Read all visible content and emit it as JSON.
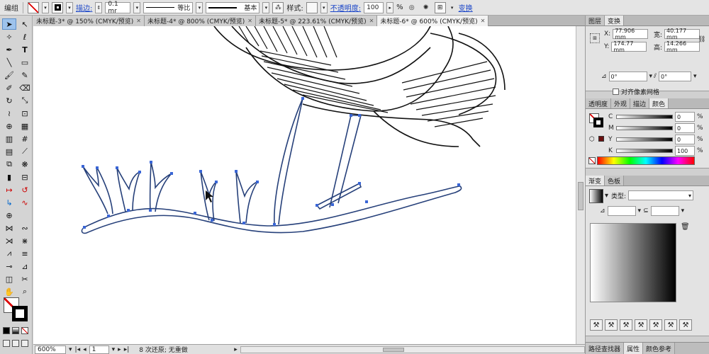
{
  "control_bar": {
    "selection_label": "编组",
    "stroke_label": "描边:",
    "stroke_value": "0.1 mr",
    "profile_uniform": "等比",
    "brush_basic": "基本",
    "style_label": "样式:",
    "opacity_label": "不透明度:",
    "opacity_value": "100",
    "opacity_unit": "%",
    "transform_label": "变换"
  },
  "tabs": [
    {
      "label": "未标题-3* @ 150% (CMYK/预览)"
    },
    {
      "label": "未标题-4* @ 800% (CMYK/预览)"
    },
    {
      "label": "未标题-5* @ 223.61% (CMYK/预览)"
    },
    {
      "label": "未标题-6* @ 600% (CMYK/预览)"
    }
  ],
  "status": {
    "zoom": "600%",
    "artboard": "1",
    "history": "8 次还原; 无重做"
  },
  "transform_panel": {
    "tab_layers": "图层",
    "tab_transform": "变换",
    "x_label": "X:",
    "x_value": "77.906 mm",
    "y_label": "Y:",
    "y_value": "174.77 mm",
    "w_label": "宽:",
    "w_value": "40.177 mm",
    "h_label": "高:",
    "h_value": "14.266 mm",
    "rotate_value": "0°",
    "shear_value": "0°",
    "align_pixel": "对齐像素网格"
  },
  "color_panel": {
    "tabs": [
      "透明度",
      "外观",
      "描边",
      "颜色"
    ],
    "channels": [
      {
        "name": "C",
        "value": "0",
        "unit": "%"
      },
      {
        "name": "M",
        "value": "0",
        "unit": "%"
      },
      {
        "name": "Y",
        "value": "0",
        "unit": "%"
      },
      {
        "name": "K",
        "value": "100",
        "unit": "%"
      }
    ]
  },
  "gradient_panel": {
    "tab_gradient": "渐变",
    "tab_swatches": "色板",
    "type_label": "类型:",
    "percent_unit": "%"
  },
  "bottom_tabs": [
    "路径查找器",
    "属性",
    "颜色参考"
  ],
  "colors": {
    "canvas": "#ffffff",
    "path_selected": "#3a66d6",
    "panel_bg": "#e3e3e3"
  }
}
